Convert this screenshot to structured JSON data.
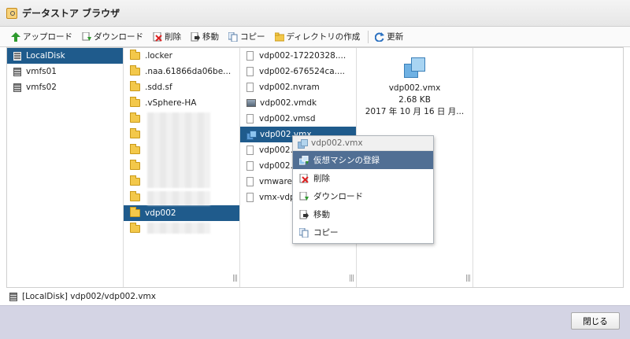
{
  "window": {
    "title": "データストア ブラウザ",
    "title_icon": "datastore-search-icon"
  },
  "toolbar": {
    "upload": "アップロード",
    "download": "ダウンロード",
    "delete": "削除",
    "move": "移動",
    "copy": "コピー",
    "new_dir": "ディレクトリの作成",
    "refresh": "更新"
  },
  "datastores": [
    "LocalDisk",
    "vmfs01",
    "vmfs02"
  ],
  "folders": {
    "named_top": [
      ".locker",
      ".naa.61866da06be...",
      ".sdd.sf",
      ".vSphere-HA"
    ],
    "selected": "vdp002"
  },
  "files": [
    "vdp002-17220328....",
    "vdp002-676524ca....",
    "vdp002.nvram",
    "vdp002.vmdk",
    "vdp002.vmsd",
    "vdp002.vmx",
    "vdp002.v",
    "vdp002.v",
    "vmware.l",
    "vmx-vdp0"
  ],
  "preview": {
    "name": "vdp002.vmx",
    "size": "2.68 KB",
    "date": "2017 年 10 月 16 日 月..."
  },
  "context_menu": {
    "header": "vdp002.vmx",
    "items": [
      "仮想マシンの登録",
      "削除",
      "ダウンロード",
      "移動",
      "コピー"
    ]
  },
  "status": {
    "path": "[LocalDisk] vdp002/vdp002.vmx"
  },
  "footer": {
    "close": "閉じる"
  },
  "colors": {
    "selection": "#1f5b8c",
    "menu_highlight": "#516f94",
    "footer_bg": "#d4d4e4"
  }
}
